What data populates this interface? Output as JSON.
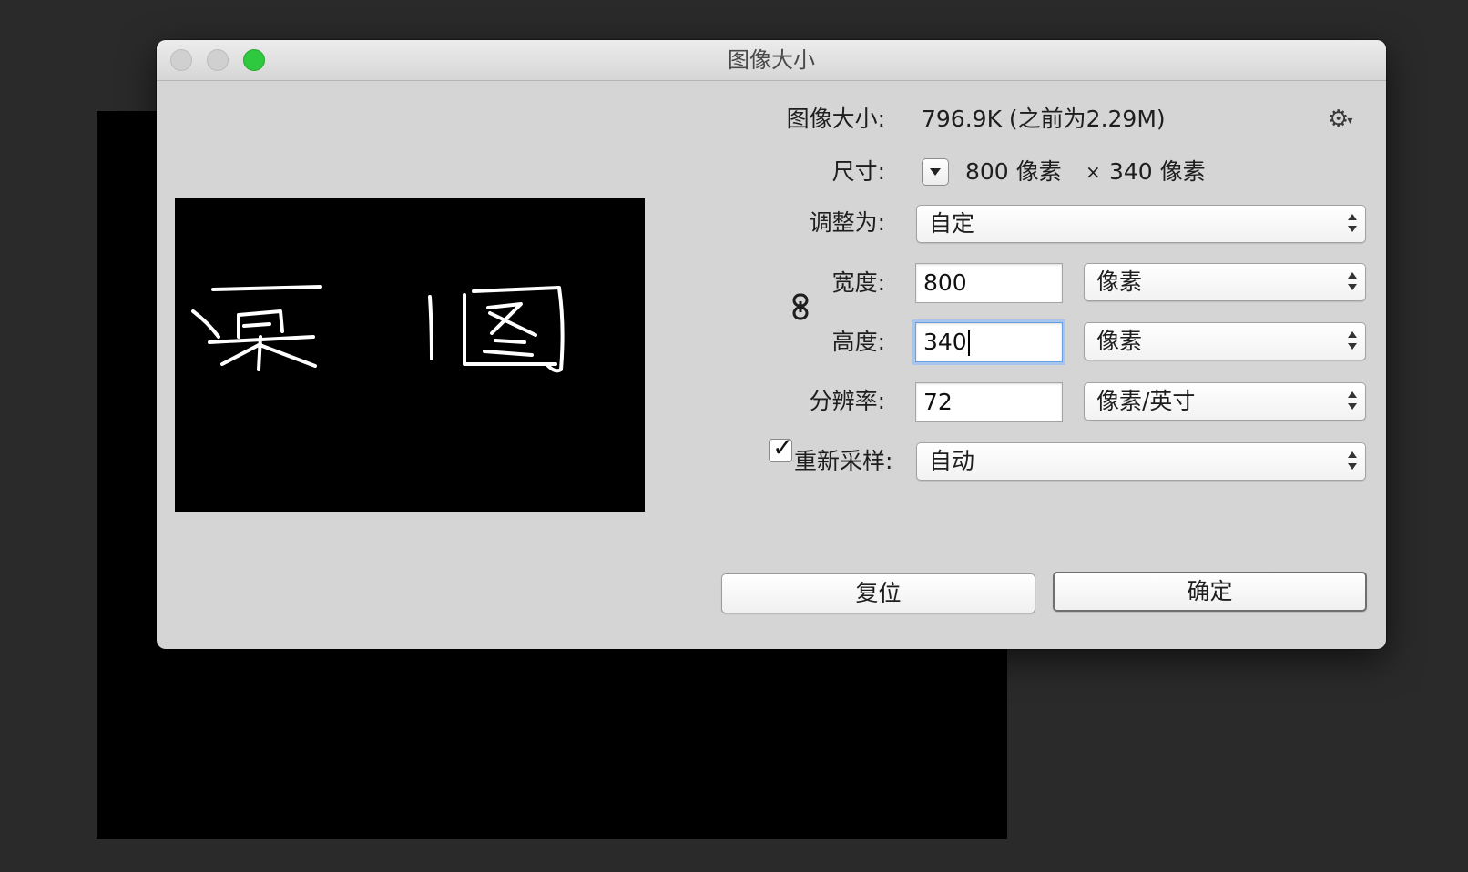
{
  "window": {
    "title": "图像大小"
  },
  "info": {
    "size_label": "图像大小:",
    "size_value": "796.9K (之前为2.29M)",
    "dimensions_label": "尺寸:",
    "dimensions_width": "800 像素",
    "dimensions_times": "×",
    "dimensions_height": "340 像素"
  },
  "fit_to": {
    "label": "调整为:",
    "value": "自定"
  },
  "width": {
    "label": "宽度:",
    "value": "800",
    "unit": "像素"
  },
  "height": {
    "label": "高度:",
    "value": "340",
    "unit": "像素"
  },
  "resolution": {
    "label": "分辨率:",
    "value": "72",
    "unit": "像素/英寸"
  },
  "resample": {
    "checked": true,
    "label": "重新采样:",
    "value": "自动"
  },
  "buttons": {
    "reset": "复位",
    "ok": "确定"
  },
  "icons": {
    "gear": "gear-icon",
    "link": "chain-link-icon",
    "dropdown": "dropdown-arrow-icon",
    "select_arrows": "updown-arrows-icon"
  },
  "colors": {
    "zoom_button": "#2fc93f",
    "preview_bg": "#000000",
    "dialog_bg": "#d5d5d5"
  }
}
